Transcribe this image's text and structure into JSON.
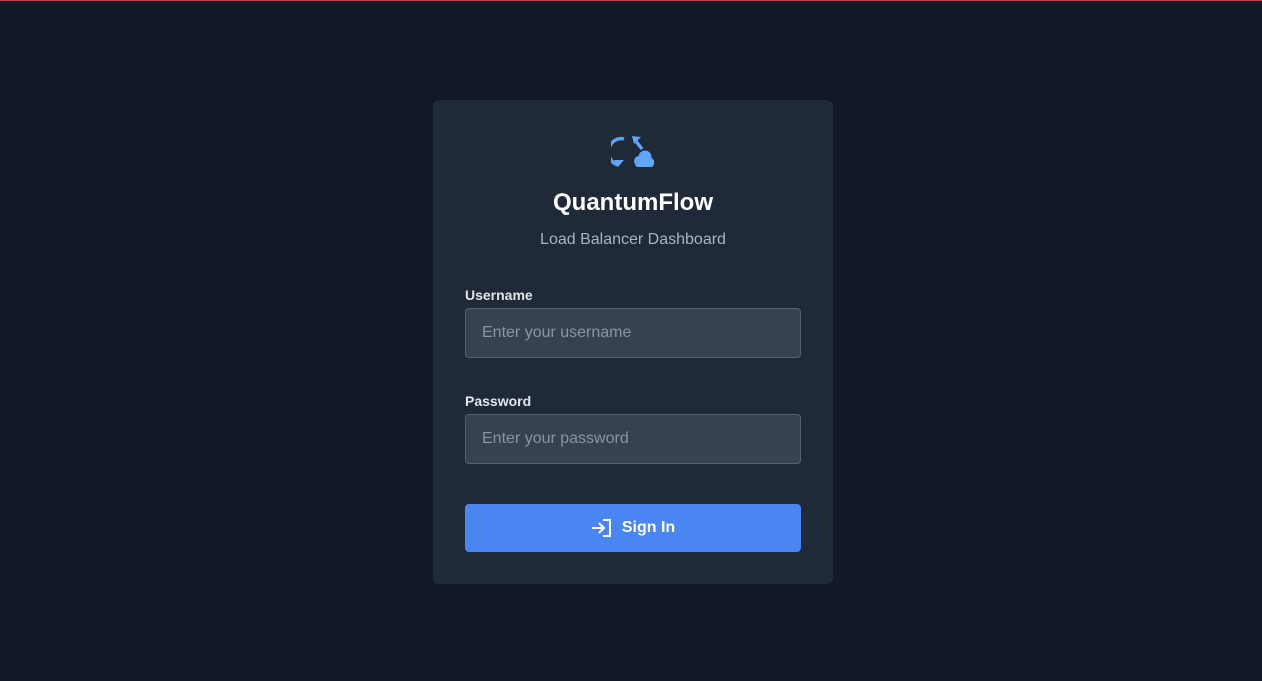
{
  "app": {
    "title": "QuantumFlow",
    "subtitle": "Load Balancer Dashboard",
    "logo_icon": "sync-cloud-icon"
  },
  "form": {
    "username": {
      "label": "Username",
      "value": "",
      "placeholder": "Enter your username"
    },
    "password": {
      "label": "Password",
      "value": "",
      "placeholder": "Enter your password"
    },
    "submit": {
      "label": "Sign In",
      "icon": "sign-in-icon"
    }
  },
  "colors": {
    "background": "#121826",
    "card": "#1f2937",
    "accent": "#4a86f2",
    "logo": "#60a5fa",
    "input_background": "#374151"
  }
}
